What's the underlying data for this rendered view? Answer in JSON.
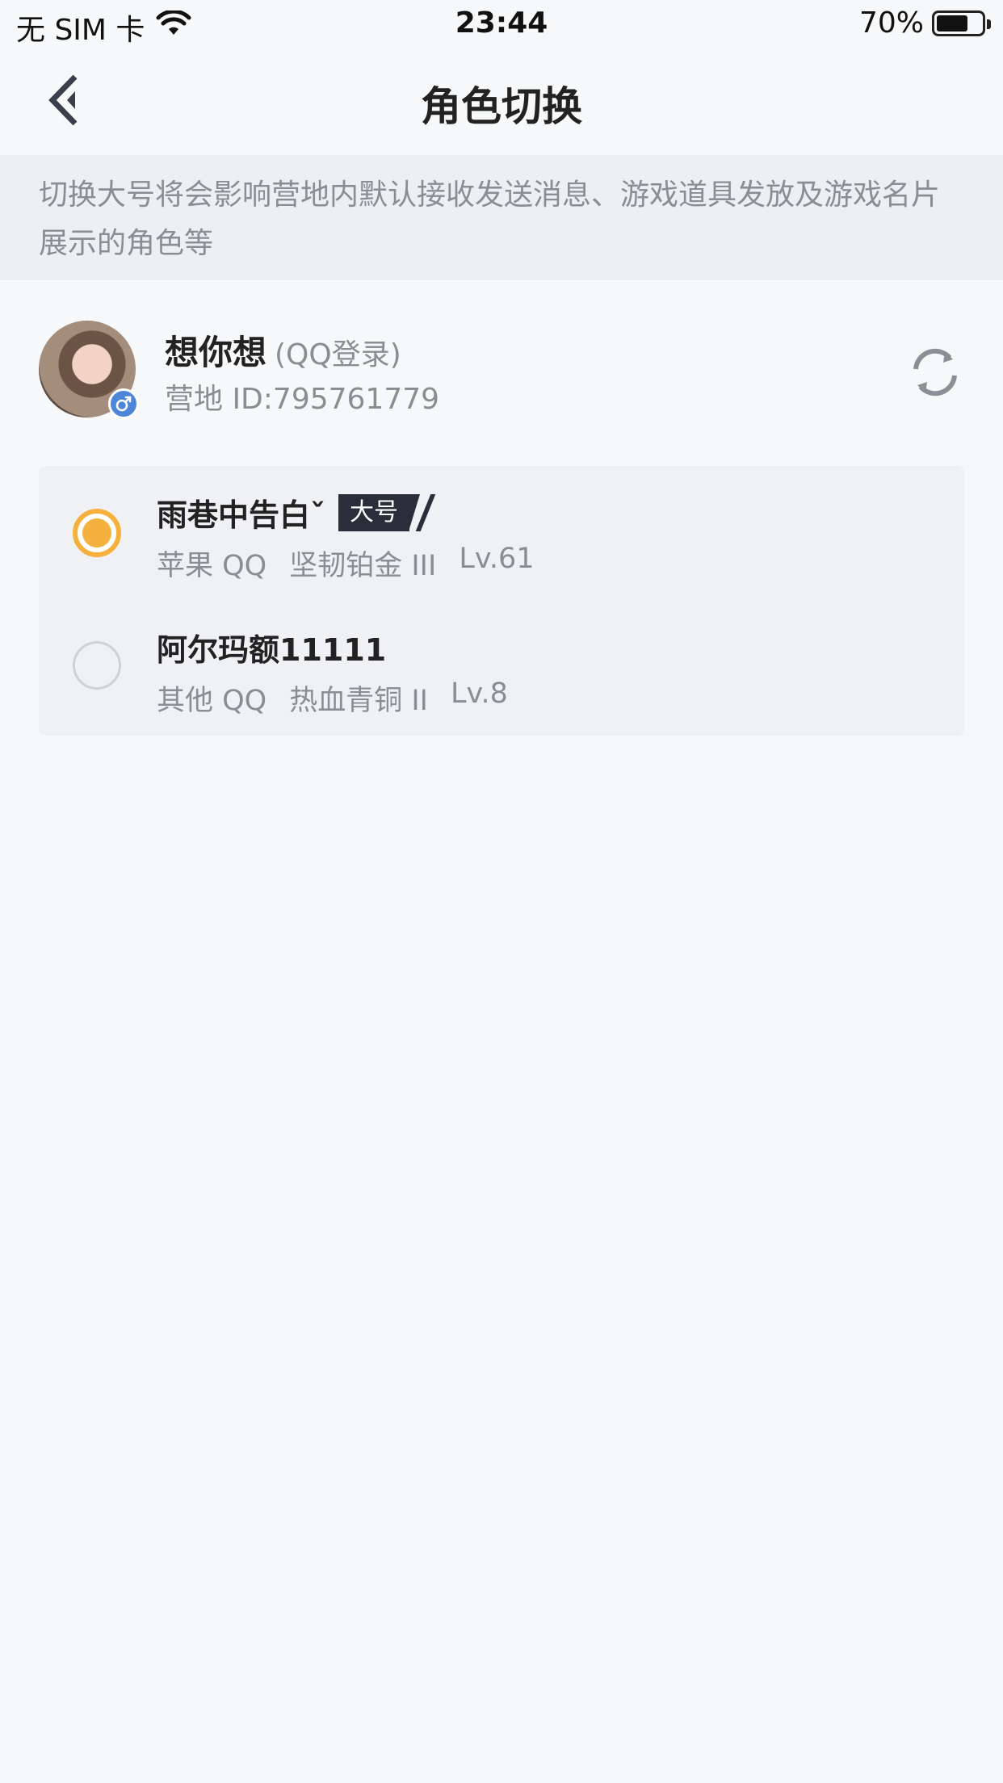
{
  "status_bar": {
    "carrier": "无 SIM 卡",
    "time": "23:44",
    "battery": "70%",
    "battery_level": 0.7
  },
  "nav": {
    "title": "角色切换"
  },
  "notice": {
    "text": "切换大号将会影响营地内默认接收发送消息、游戏道具发放及游戏名片展示的角色等"
  },
  "account": {
    "name": "想你想",
    "login_type": "(QQ登录)",
    "camp_id": "营地 ID:795761779"
  },
  "roles": [
    {
      "name": "雨巷中告白ˇ",
      "badge": "大号",
      "platform": "苹果 QQ",
      "rank": "坚韧铂金 III",
      "level": "Lv.61",
      "selected": true
    },
    {
      "name": "阿尔玛额11111",
      "badge": "",
      "platform": "其他 QQ",
      "rank": "热血青铜 II",
      "level": "Lv.8",
      "selected": false
    }
  ],
  "colors": {
    "accent": "#f5b13e",
    "badge_bg": "#2a2d3a",
    "gender_male": "#4d86d8"
  }
}
